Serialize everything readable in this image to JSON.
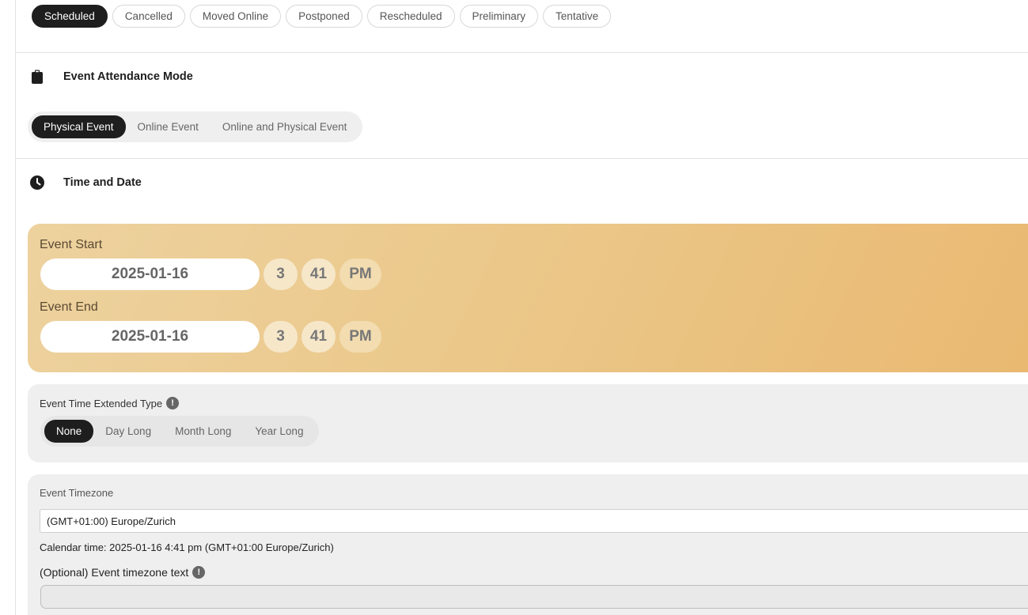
{
  "status": {
    "options": [
      "Scheduled",
      "Cancelled",
      "Moved Online",
      "Postponed",
      "Rescheduled",
      "Preliminary",
      "Tentative"
    ],
    "selected": "Scheduled"
  },
  "attendance": {
    "title": "Event Attendance Mode",
    "icon": "clipboard-icon",
    "options": [
      "Physical Event",
      "Online Event",
      "Online and Physical Event"
    ],
    "selected": "Physical Event"
  },
  "time_date": {
    "title": "Time and Date",
    "icon": "clock-icon",
    "start": {
      "label": "Event Start",
      "date": "2025-01-16",
      "hour": "3",
      "minute": "41",
      "ampm": "PM"
    },
    "end": {
      "label": "Event End",
      "date": "2025-01-16",
      "hour": "3",
      "minute": "41",
      "ampm": "PM"
    }
  },
  "extended": {
    "label": "Event Time Extended Type",
    "info": "!",
    "options": [
      "None",
      "Day Long",
      "Month Long",
      "Year Long"
    ],
    "selected": "None"
  },
  "timezone": {
    "label": "Event Timezone",
    "value": "(GMT+01:00) Europe/Zurich",
    "calendar_time": "Calendar time: 2025-01-16 4:41 pm (GMT+01:00 Europe/Zurich)",
    "optional_label": "(Optional) Event timezone text",
    "optional_info": "!",
    "optional_value": ""
  },
  "colors": {
    "dark": "#1e1e1e",
    "gold_start": "#edd29f",
    "gold_end": "#e9b870",
    "card_bg": "#efefef"
  }
}
